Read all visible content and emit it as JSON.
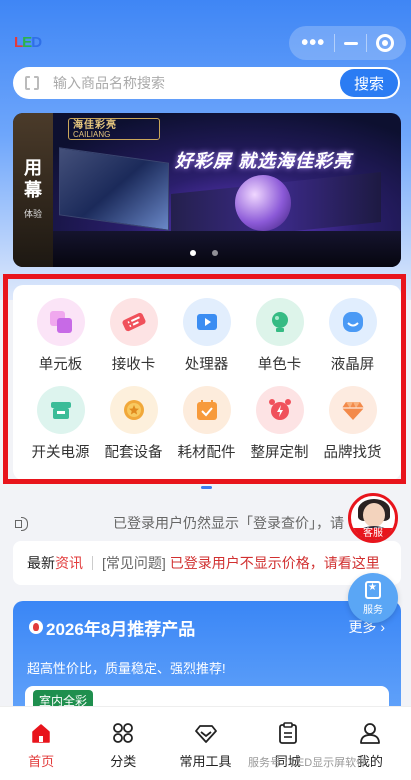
{
  "header": {
    "logo_text": "LED"
  },
  "search": {
    "placeholder": "输入商品名称搜索",
    "button": "搜索"
  },
  "banner": {
    "brand_cn": "海佳彩亮",
    "brand_en": "CAILIANG",
    "slogan": "好彩屏 就选海佳彩亮",
    "side_text": "用 幕",
    "side_sub": "体验"
  },
  "categories": [
    {
      "label": "单元板",
      "icon": "cube-icon",
      "bg": "#fbe4f7",
      "color": "#c76ae6"
    },
    {
      "label": "接收卡",
      "icon": "ticket-icon",
      "bg": "#fde3e4",
      "color": "#f0515b"
    },
    {
      "label": "处理器",
      "icon": "video-icon",
      "bg": "#e2eefd",
      "color": "#3b8df2"
    },
    {
      "label": "单色卡",
      "icon": "bulb-icon",
      "bg": "#ddf4ea",
      "color": "#36bb84"
    },
    {
      "label": "液晶屏",
      "icon": "smiley-icon",
      "bg": "#e1eefe",
      "color": "#4b9af5"
    },
    {
      "label": "开关电源",
      "icon": "store-icon",
      "bg": "#ddf4ee",
      "color": "#3bbc98"
    },
    {
      "label": "配套设备",
      "icon": "coin-star-icon",
      "bg": "#fdf0dc",
      "color": "#f1a83a"
    },
    {
      "label": "耗材配件",
      "icon": "calendar-check-icon",
      "bg": "#fdecdc",
      "color": "#f79a3b"
    },
    {
      "label": "整屏定制",
      "icon": "alarm-clock-icon",
      "bg": "#fde3e4",
      "color": "#f0515b"
    },
    {
      "label": "品牌找货",
      "icon": "diamond-icon",
      "bg": "#fdebe0",
      "color": "#f38a4a"
    }
  ],
  "notice": {
    "text": "已登录用户仍然显示「登录查价」，请"
  },
  "news": {
    "label_a": "最新",
    "label_b": "资讯",
    "category": "[常见问题]",
    "text": "已登录用户不显示价格，请看这里"
  },
  "recommend": {
    "title": "2026年8月推荐产品",
    "more": "更多",
    "subtitle": "超高性价比，质量稳定、强烈推荐!",
    "tag": "室内全彩"
  },
  "float": {
    "customer_service": "客服",
    "service": "服务"
  },
  "tabs": [
    {
      "label": "首页",
      "icon": "home-icon",
      "active": true
    },
    {
      "label": "分类",
      "icon": "grid-icon",
      "active": false
    },
    {
      "label": "常用工具",
      "icon": "diamond-outline-icon",
      "active": false
    },
    {
      "label": "同城",
      "icon": "clipboard-icon",
      "active": false
    },
    {
      "label": "我的",
      "icon": "user-icon",
      "active": false
    }
  ],
  "watermark": "服务号 · LED显示屏软件"
}
